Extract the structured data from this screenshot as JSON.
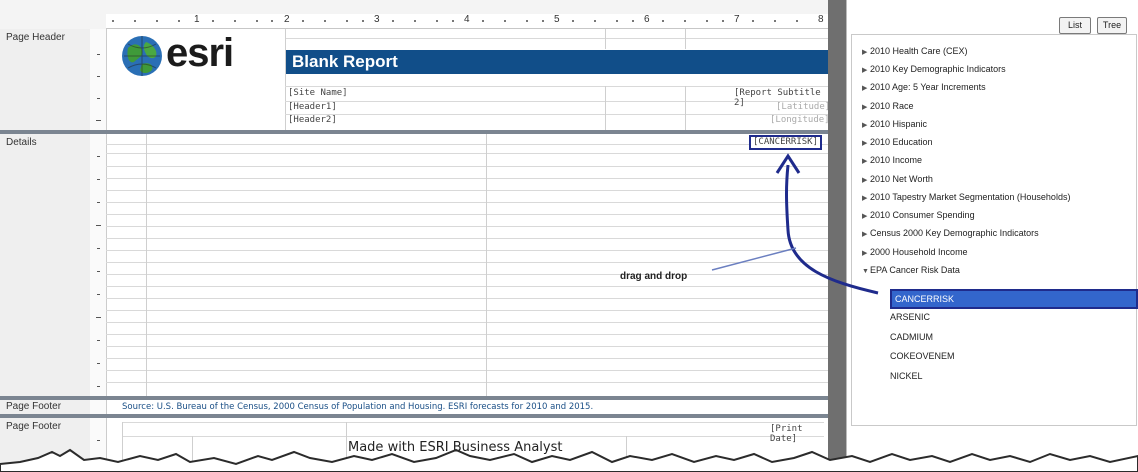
{
  "ruler": {
    "numbers": [
      "1",
      "2",
      "3",
      "4",
      "5",
      "6",
      "7",
      "8"
    ]
  },
  "bands": {
    "page_header": "Page Header",
    "details": "Details",
    "page_footer_1": "Page Footer",
    "page_footer_2": "Page Footer"
  },
  "header": {
    "logo_text": "esri",
    "title": "Blank Report",
    "site_name": "[Site Name]",
    "report_subtitle": "[Report Subtitle 2]",
    "header1": "[Header1]",
    "header2": "[Header2]",
    "latitude": "[Latitude]",
    "longitude": "[Longitude]"
  },
  "details": {
    "field": "[CANCERRISK]"
  },
  "annotation": {
    "drag_label": "drag and drop"
  },
  "footer": {
    "source_text": "Source: U.S. Bureau of the Census, 2000 Census of Population and Housing. ESRI forecasts for 2010 and 2015.",
    "print_date": "[Print Date]",
    "made_with": "Made with ESRI Business Analyst"
  },
  "panel": {
    "list_button": "List",
    "tree_button": "Tree",
    "items": [
      "2010 Health Care (CEX)",
      "2010 Key Demographic Indicators",
      "2010 Age: 5 Year Increments",
      "2010 Race",
      "2010 Hispanic",
      "2010 Education",
      "2010 Income",
      "2010 Net Worth",
      "2010 Tapestry Market Segmentation (Households)",
      "2010 Consumer Spending",
      "Census 2000 Key Demographic Indicators",
      "2000 Household Income",
      "EPA Cancer Risk Data"
    ],
    "children": [
      "CANCERRISK",
      "ARSENIC",
      "CADMIUM",
      "COKEOVENEM",
      "NICKEL"
    ],
    "selected_child": "CANCERRISK"
  },
  "colors": {
    "title_bar": "#114e89",
    "selection": "#3366cc",
    "arrow": "#1f2b8c"
  }
}
